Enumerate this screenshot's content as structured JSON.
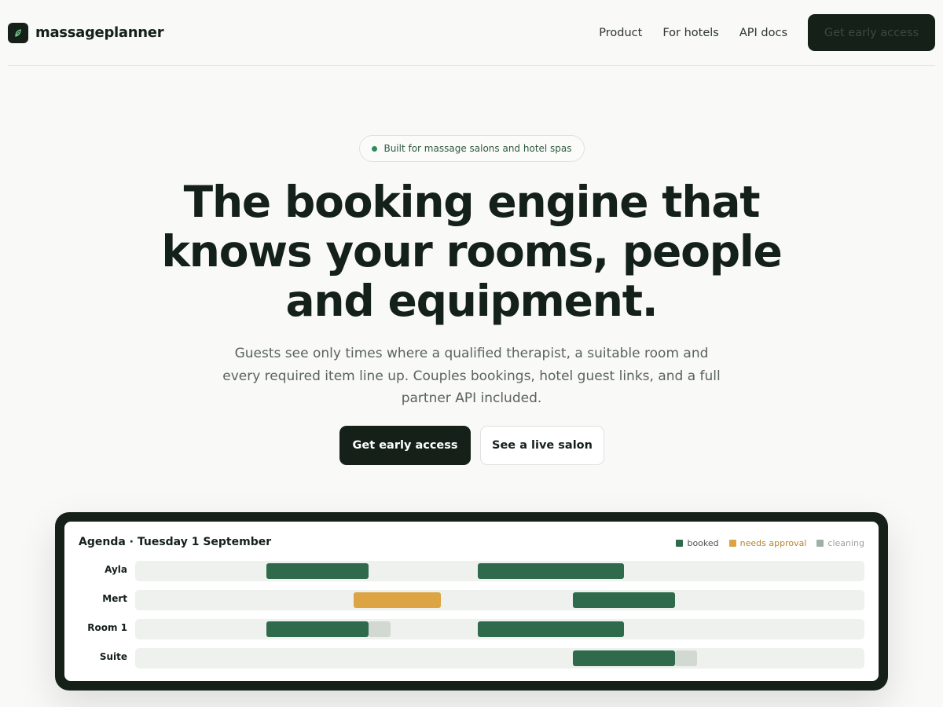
{
  "brand": {
    "name": "massageplanner",
    "logo_icon": "leaf-icon"
  },
  "nav": {
    "links": [
      "Product",
      "For hotels",
      "API docs"
    ],
    "cta": "Get early access"
  },
  "hero": {
    "badge": "Built for massage salons and hotel spas",
    "headline": "The booking engine that knows your rooms, people and equipment.",
    "subtitle": "Guests see only times where a qualified therapist, a suitable room and every required item line up. Couples bookings, hotel guest links, and a full partner API included.",
    "primary_cta": "Get early access",
    "secondary_cta": "See a live salon"
  },
  "agenda": {
    "title": "Agenda · Tuesday 1 September",
    "legend": [
      {
        "key": "booked",
        "label": "booked",
        "color": "#2f6a4c",
        "text_color": "#4b554f"
      },
      {
        "key": "approval",
        "label": "needs approval",
        "color": "#d9a441",
        "text_color": "#b5862b"
      },
      {
        "key": "cleaning",
        "label": "cleaning",
        "color": "#9fb0a4",
        "text_color": "#9aa49e"
      }
    ],
    "colors": {
      "booked": "#2f6a4c",
      "approval": "#dca442",
      "cleaning": "#d1d9d2",
      "track": "#eef1ed"
    },
    "rows": [
      {
        "label": "Ayla",
        "segments": [
          {
            "type": "booked",
            "start": 0.18,
            "end": 0.32
          },
          {
            "type": "booked",
            "start": 0.47,
            "end": 0.67
          }
        ]
      },
      {
        "label": "Mert",
        "segments": [
          {
            "type": "approval",
            "start": 0.3,
            "end": 0.42
          },
          {
            "type": "booked",
            "start": 0.6,
            "end": 0.74
          }
        ]
      },
      {
        "label": "Room 1",
        "segments": [
          {
            "type": "booked",
            "start": 0.18,
            "end": 0.32
          },
          {
            "type": "cleaning",
            "start": 0.32,
            "end": 0.35
          },
          {
            "type": "booked",
            "start": 0.47,
            "end": 0.67
          }
        ]
      },
      {
        "label": "Suite",
        "segments": [
          {
            "type": "booked",
            "start": 0.6,
            "end": 0.74
          },
          {
            "type": "cleaning",
            "start": 0.74,
            "end": 0.77
          }
        ]
      }
    ]
  }
}
